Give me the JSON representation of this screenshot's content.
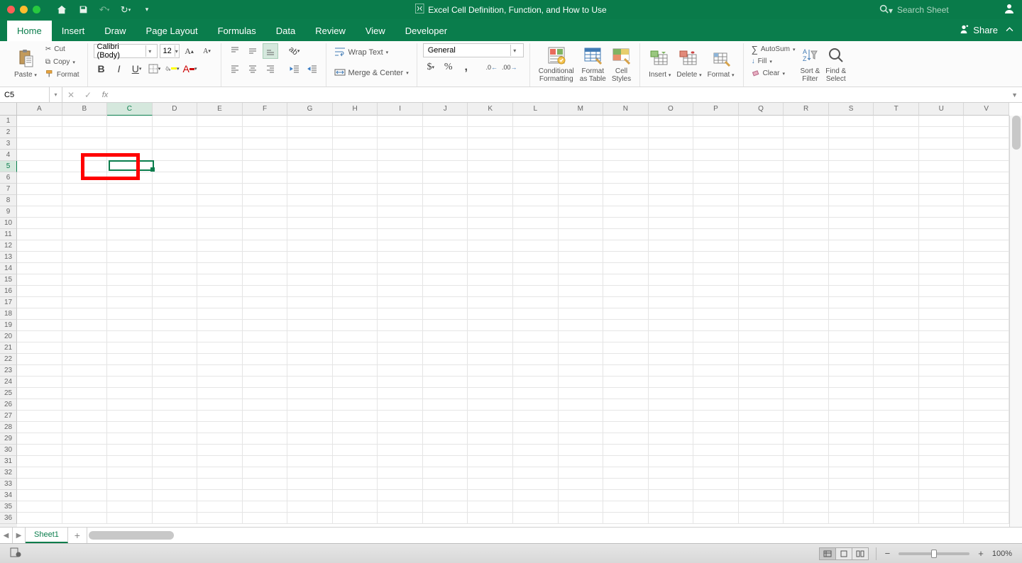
{
  "title_bar": {
    "document_title": "Excel Cell Definition, Function, and How to Use",
    "search_placeholder": "Search Sheet"
  },
  "ribbon": {
    "tabs": [
      "Home",
      "Insert",
      "Draw",
      "Page Layout",
      "Formulas",
      "Data",
      "Review",
      "View",
      "Developer"
    ],
    "active_tab": "Home",
    "share_label": "Share"
  },
  "clipboard": {
    "paste": "Paste",
    "cut": "Cut",
    "copy": "Copy",
    "format_painter": "Format"
  },
  "font": {
    "name": "Calibri (Body)",
    "size": "12"
  },
  "alignment": {
    "wrap_text": "Wrap Text",
    "merge_center": "Merge & Center"
  },
  "number": {
    "format": "General"
  },
  "styles": {
    "conditional": "Conditional\nFormatting",
    "format_table": "Format\nas Table",
    "cell_styles": "Cell\nStyles"
  },
  "cells": {
    "insert": "Insert",
    "delete": "Delete",
    "format": "Format"
  },
  "editing": {
    "autosum": "AutoSum",
    "fill": "Fill",
    "clear": "Clear",
    "sort_filter": "Sort &\nFilter",
    "find_select": "Find &\nSelect"
  },
  "formula_bar": {
    "name_box": "C5",
    "formula": ""
  },
  "grid": {
    "columns": [
      "A",
      "B",
      "C",
      "D",
      "E",
      "F",
      "G",
      "H",
      "I",
      "J",
      "K",
      "L",
      "M",
      "N",
      "O",
      "P",
      "Q",
      "R",
      "S",
      "T",
      "U",
      "V"
    ],
    "rows": 36,
    "active_cell": {
      "col": 2,
      "row": 4
    },
    "sheet_tabs": [
      "Sheet1"
    ]
  },
  "status_bar": {
    "zoom": "100%"
  }
}
